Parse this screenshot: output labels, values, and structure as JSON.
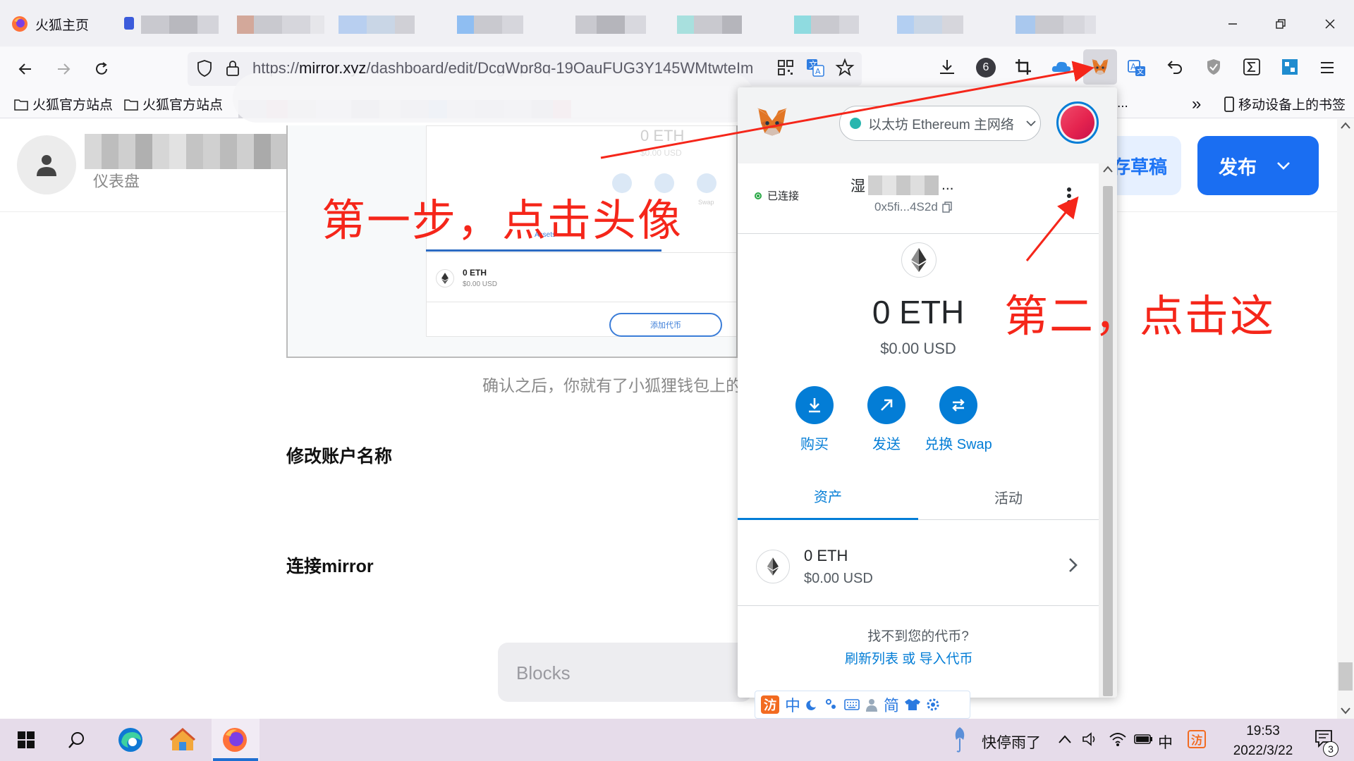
{
  "browser": {
    "active_tab_title": "火狐主页",
    "url_prefix": "https://",
    "url_host": "mirror.xyz",
    "url_rest": "/dashboard/edit/DcgWpr8q-19OauFUG3Y145WMtwteIm",
    "toolbar_badge_count": "6",
    "bookmarks": [
      "火狐官方站点",
      "火狐官方站点"
    ],
    "mobile_bookmarks": "移动设备上的书签",
    "overflow_chevron": "»",
    "bookmark_trailing": "..."
  },
  "page": {
    "dashboard_label": "仪表盘",
    "save_draft_label": "存草稿",
    "publish_label": "发布",
    "caption": "确认之后，你就有了小狐狸钱包上的",
    "heading_rename": "修改账户名称",
    "heading_connect": "连接mirror",
    "blocks_placeholder": "Blocks",
    "screenshot": {
      "balance_top": "0 ETH",
      "balance_top_usd": "$0.00 USD",
      "tab": "Assets",
      "asset_amount": "0 ETH",
      "asset_usd": "$0.00 USD",
      "add_token": "添加代币",
      "action_swap": "Swap"
    }
  },
  "metamask": {
    "network": "以太坊 Ethereum 主网络",
    "connected_label": "已连接",
    "account_name_prefix": "湿",
    "account_name_suffix": "...",
    "account_address": "0x5fi...4S2d",
    "balance": "0 ETH",
    "balance_usd": "$0.00 USD",
    "actions": [
      {
        "label": "购买",
        "icon": "download-icon"
      },
      {
        "label": "发送",
        "icon": "arrow-up-right-icon"
      },
      {
        "label": "兑换 Swap",
        "icon": "swap-icon"
      }
    ],
    "tabs": [
      "资产",
      "活动"
    ],
    "asset": {
      "amount": "0 ETH",
      "usd": "$0.00 USD"
    },
    "cant_find": "找不到您的代币?",
    "refresh_link": "刷新列表 或 导入代币"
  },
  "ime": {
    "items": [
      "中",
      "简"
    ]
  },
  "annotations": {
    "step1": "第一步，点击头像",
    "step2": "第二，点击这"
  },
  "taskbar": {
    "weather": "快停雨了",
    "ime_indicator": "中",
    "time": "19:53",
    "date": "2022/3/22",
    "notification_count": "3"
  },
  "colors": {
    "metamask_blue": "#037dd6",
    "annotation_red": "#f5261a",
    "publish_blue": "#1a6ef2"
  }
}
